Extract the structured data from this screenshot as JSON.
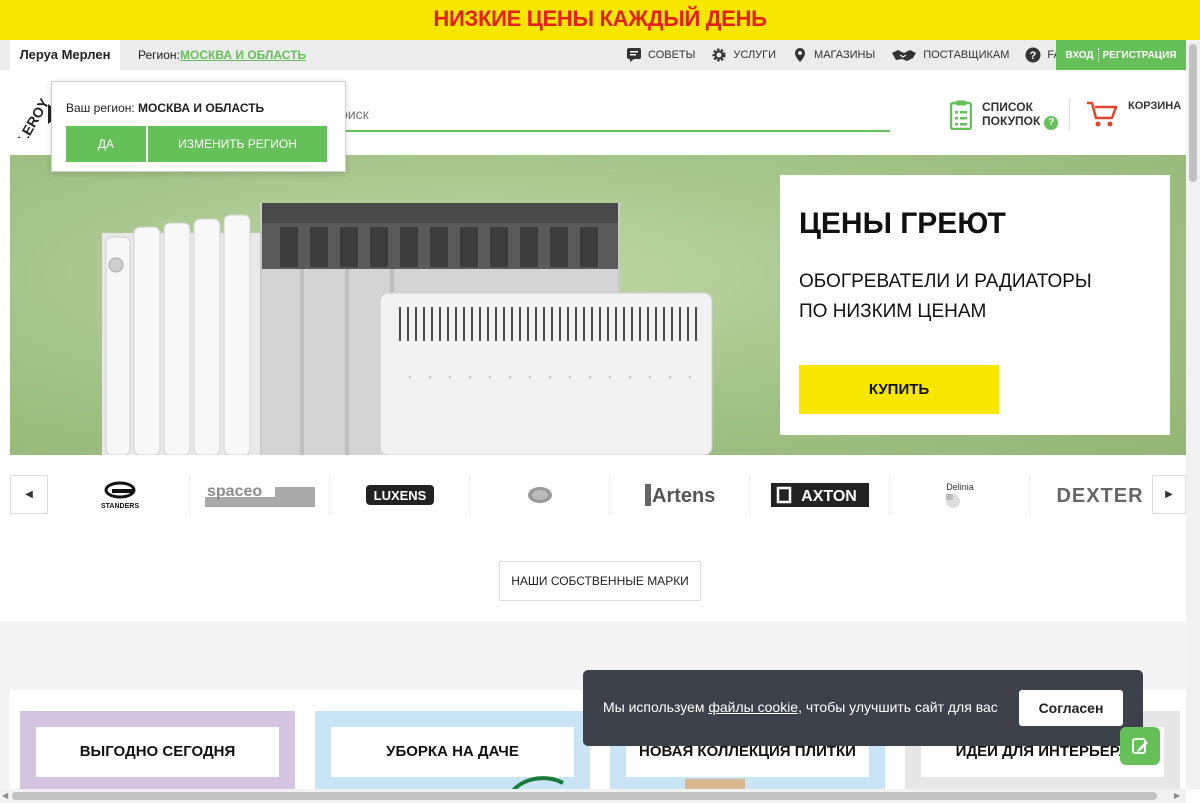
{
  "promo": {
    "text": "НИЗКИЕ ЦЕНЫ КАЖДЫЙ ДЕНЬ"
  },
  "topnav": {
    "brand": "Леруа Мерлен",
    "region_label": "Регион:",
    "region_value": "МОСКВА И ОБЛАСТЬ",
    "links": [
      {
        "label": "СОВЕТЫ",
        "icon": "chat-icon"
      },
      {
        "label": "УСЛУГИ",
        "icon": "gear-icon"
      },
      {
        "label": "МАГАЗИНЫ",
        "icon": "map-pin-icon"
      },
      {
        "label": "ПОСТАВЩИКАМ",
        "icon": "handshake-icon"
      },
      {
        "label": "FAQ",
        "icon": "question-icon"
      }
    ],
    "login": "ВХОД",
    "register": "РЕГИСТРАЦИЯ"
  },
  "header": {
    "logo_text": "LEROY",
    "search_placeholder": "Поиск",
    "shoplist_line1": "СПИСОК",
    "shoplist_line2": "ПОКУПОК",
    "shoplist_help": "?",
    "cart_label": "КОРЗИНА"
  },
  "region_popup": {
    "question": "Ваш регион:",
    "region": "МОСКВА И ОБЛАСТЬ",
    "yes": "ДА",
    "change": "ИЗМЕНИТЬ РЕГИОН"
  },
  "hero": {
    "title": "ЦЕНЫ ГРЕЮТ",
    "subtitle_line1": "ОБОГРЕВАТЕЛИ И РАДИАТОРЫ",
    "subtitle_line2": "ПО НИЗКИМ ЦЕНАМ",
    "button": "КУПИТЬ"
  },
  "brands": {
    "prev": "◀",
    "next": "▶",
    "items": [
      "STANDERS",
      "spaceo",
      "LUXENS",
      "",
      "Artens",
      "AXTON",
      "Delinia",
      "DEXTER"
    ]
  },
  "own_brands_button": "НАШИ СОБСТВЕННЫЕ МАРКИ",
  "tiles": [
    {
      "label": "ВЫГОДНО СЕГОДНЯ",
      "color": "#d4c4e0"
    },
    {
      "label": "УБОРКА НА ДАЧЕ",
      "color": "#c9e4f5"
    },
    {
      "label": "НОВАЯ КОЛЛЕКЦИЯ ПЛИТКИ",
      "color": "#c9e4f5"
    },
    {
      "label": "ИДЕИ ДЛЯ ИНТЕРЬЕРА",
      "color": "#e6e6e6"
    }
  ],
  "cookie": {
    "text_before": "Мы используем ",
    "link": "файлы cookie",
    "text_after": ", чтобы улучшить сайт для вас",
    "button": "Согласен"
  },
  "colors": {
    "brand_green": "#66c05a",
    "promo_yellow": "#f6e600",
    "promo_red": "#e32117"
  }
}
